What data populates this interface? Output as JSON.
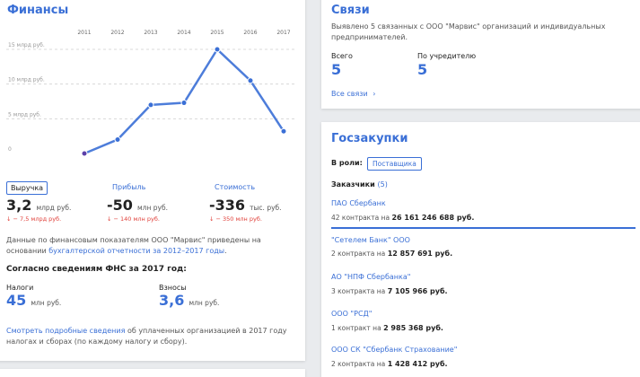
{
  "finance": {
    "title": "Финансы",
    "years": [
      "2011",
      "2012",
      "2013",
      "2014",
      "2015",
      "2016",
      "2017"
    ],
    "y_ticks": [
      "15 млрд руб.",
      "10 млрд руб.",
      "5 млрд руб.",
      "0"
    ],
    "tabs": [
      "Выручка",
      "Прибыль",
      "Стоимость"
    ],
    "metrics": [
      {
        "value": "3,2",
        "unit": "млрд руб.",
        "change": "↓ − 7,5 млрд руб."
      },
      {
        "value": "-50",
        "unit": "млн руб.",
        "change": "↓ − 140 млн руб."
      },
      {
        "value": "-336",
        "unit": "тыс. руб.",
        "change": "↓ − 350 млн руб."
      }
    ],
    "note_prefix": "Данные по финансовым показателям ООО \"Марвис\" приведены на основании",
    "note_link": "бухгалтерской отчетности за 2012–2017 годы",
    "note_suffix": ".",
    "fns_title": "Согласно сведениям ФНС за 2017 год:",
    "taxes_label": "Налоги",
    "taxes_value": "45",
    "taxes_unit": "млн руб.",
    "fees_label": "Взносы",
    "fees_value": "3,6",
    "fees_unit": "млн руб.",
    "bottom_link": "Смотреть подробные сведения",
    "bottom_text_1": "об уплаченных организацией в 2017 году",
    "bottom_text_2": "налогах и сборах (по каждому налогу и сбору)."
  },
  "chart_data": {
    "type": "line",
    "x": [
      "2011",
      "2012",
      "2013",
      "2014",
      "2015",
      "2016",
      "2017"
    ],
    "series": [
      {
        "values": [
          0,
          2,
          7,
          7.3,
          15,
          10.5,
          3.2
        ]
      }
    ],
    "ylim": [
      0,
      15
    ],
    "yunit": "млрд руб.",
    "grid": true,
    "line_color": "#3a6fd6",
    "first_point_color": "#5b3fa8"
  },
  "svyazi": {
    "title": "Связи",
    "desc_1": "Выявлено 5 связанных с ООО \"Марвис\" организаций и индивидуальных",
    "desc_2": "предпринимателей.",
    "total_label": "Всего",
    "total_value": "5",
    "founder_label": "По учредителю",
    "founder_value": "5",
    "all_link": "Все связи",
    "arrow": "›"
  },
  "goszakupki": {
    "title": "Госзакупки",
    "role_label": "В роли:",
    "role_button": "Поставщика",
    "customers_label": "Заказчики",
    "customers_count": "(5)",
    "customers": [
      {
        "name": "ПАО Сбербанк",
        "detail": "42 контракта на",
        "amount": "26 161 246 688 руб."
      },
      {
        "name": "\"Сетелем Банк\" ООО",
        "detail": "2 контракта на",
        "amount": "12 857 691 руб."
      },
      {
        "name": "АО \"НПФ Сбербанка\"",
        "detail": "3 контракта на",
        "amount": "7 105 966 руб."
      },
      {
        "name": "ООО \"РСД\"",
        "detail": "1 контракт на",
        "amount": "2 985 368 руб."
      },
      {
        "name": "ООО СК \"Сбербанк Страхование\"",
        "detail": "2 контракта на",
        "amount": "1 428 412 руб."
      }
    ]
  }
}
